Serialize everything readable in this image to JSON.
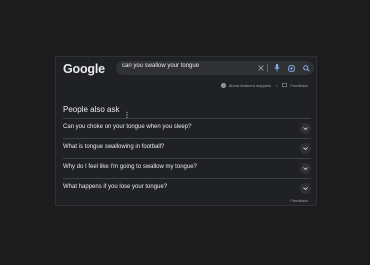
{
  "header": {
    "logo": "Google",
    "search": {
      "value": "can you swallow your tongue"
    },
    "icons": {
      "clear": "close-icon",
      "mic": "mic-icon",
      "lens": "lens-icon",
      "search": "search-icon"
    }
  },
  "snippet_bar": {
    "about_label": "About featured snippets",
    "separator": "•",
    "feedback_label": "Feedback"
  },
  "people_also_ask": {
    "title": "People also ask",
    "questions": [
      "Can you choke on your tongue when you sleep?",
      "What is tongue swallowing in football?",
      "Why do I feel like I'm going to swallow my tongue?",
      "What happens if you lose your tongue?"
    ],
    "feedback_label": "Feedback"
  },
  "colors": {
    "background": "#1c1c1c",
    "card": "#202124",
    "text": "#e8eaed",
    "muted": "#9aa0a6",
    "accent_blue": "#8ab4f8"
  }
}
